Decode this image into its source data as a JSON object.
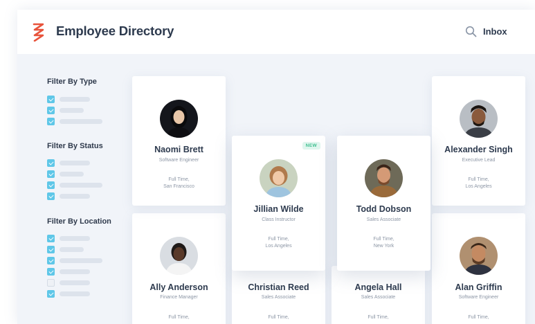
{
  "header": {
    "title": "Employee Directory",
    "inbox_label": "Inbox",
    "logo_icon": "zigzag-logo-icon",
    "search_icon": "search-icon"
  },
  "filters": [
    {
      "title": "Filter By Type",
      "options": [
        true,
        true,
        true
      ]
    },
    {
      "title": "Filter By Status",
      "options": [
        true,
        true,
        true,
        true
      ]
    },
    {
      "title": "Filter By Location",
      "options": [
        true,
        true,
        true,
        true,
        false,
        true
      ]
    }
  ],
  "employees": [
    {
      "name": "Naomi Brett",
      "role": "Software Engineer",
      "type": "Full Time,",
      "location": "San Francisco",
      "new": false
    },
    {
      "name": "Jillian Wilde",
      "role": "Class Instructor",
      "type": "Full Time,",
      "location": "Los Angeles",
      "new": true,
      "badge": "NEW"
    },
    {
      "name": "Todd Dobson",
      "role": "Sales Associate",
      "type": "Full Time,",
      "location": "New York",
      "new": false
    },
    {
      "name": "Alexander Singh",
      "role": "Executive Lead",
      "type": "Full Time,",
      "location": "Los Angeles",
      "new": false
    },
    {
      "name": "Ally Anderson",
      "role": "Finance Manager",
      "type": "Full Time,",
      "location": "",
      "new": false
    },
    {
      "name": "Christian Reed",
      "role": "Sales Associate",
      "type": "Full Time,",
      "location": "",
      "new": false
    },
    {
      "name": "Angela Hall",
      "role": "Sales Associate",
      "type": "Full Time,",
      "location": "",
      "new": false
    },
    {
      "name": "Alan Griffin",
      "role": "Software Engineer",
      "type": "Full Time,",
      "location": "",
      "new": false
    }
  ],
  "colors": {
    "accent": "#e8533b",
    "checkbox": "#5fc7e8",
    "new_badge_bg": "#dff6ee",
    "new_badge_text": "#3fbf8f",
    "background": "#f1f4f9",
    "title_text": "#2d3a4e"
  }
}
